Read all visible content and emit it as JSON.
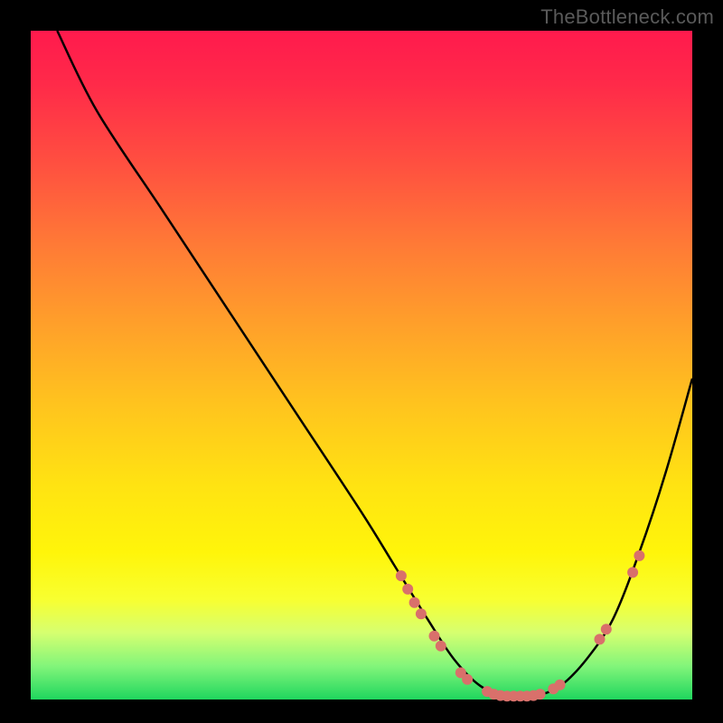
{
  "watermark": "TheBottleneck.com",
  "chart_data": {
    "type": "line",
    "title": "",
    "xlabel": "",
    "ylabel": "",
    "xlim": [
      0,
      100
    ],
    "ylim": [
      0,
      100
    ],
    "grid": false,
    "legend": false,
    "series": [
      {
        "name": "curve",
        "x": [
          4,
          10,
          20,
          30,
          40,
          50,
          55,
          60,
          64,
          68,
          72,
          76,
          80,
          84,
          88,
          92,
          96,
          100
        ],
        "y": [
          100,
          88,
          73,
          58,
          43,
          28,
          20,
          12,
          6,
          2,
          0.5,
          0.5,
          2,
          6,
          12,
          22,
          34,
          48
        ]
      }
    ],
    "markers": [
      {
        "x": 56,
        "y": 18.5
      },
      {
        "x": 57,
        "y": 16.5
      },
      {
        "x": 58,
        "y": 14.5
      },
      {
        "x": 59,
        "y": 12.8
      },
      {
        "x": 61,
        "y": 9.5
      },
      {
        "x": 62,
        "y": 8.0
      },
      {
        "x": 65,
        "y": 4.0
      },
      {
        "x": 66,
        "y": 3.0
      },
      {
        "x": 69,
        "y": 1.2
      },
      {
        "x": 70,
        "y": 0.8
      },
      {
        "x": 71,
        "y": 0.6
      },
      {
        "x": 72,
        "y": 0.5
      },
      {
        "x": 73,
        "y": 0.5
      },
      {
        "x": 74,
        "y": 0.5
      },
      {
        "x": 75,
        "y": 0.5
      },
      {
        "x": 76,
        "y": 0.6
      },
      {
        "x": 77,
        "y": 0.8
      },
      {
        "x": 79,
        "y": 1.6
      },
      {
        "x": 80,
        "y": 2.2
      },
      {
        "x": 86,
        "y": 9.0
      },
      {
        "x": 87,
        "y": 10.5
      },
      {
        "x": 91,
        "y": 19.0
      },
      {
        "x": 92,
        "y": 21.5
      }
    ],
    "background_gradient": {
      "stops": [
        {
          "pos": 0,
          "color": "#ff1a4d"
        },
        {
          "pos": 50,
          "color": "#ffc41e"
        },
        {
          "pos": 100,
          "color": "#1fd65e"
        }
      ]
    }
  }
}
